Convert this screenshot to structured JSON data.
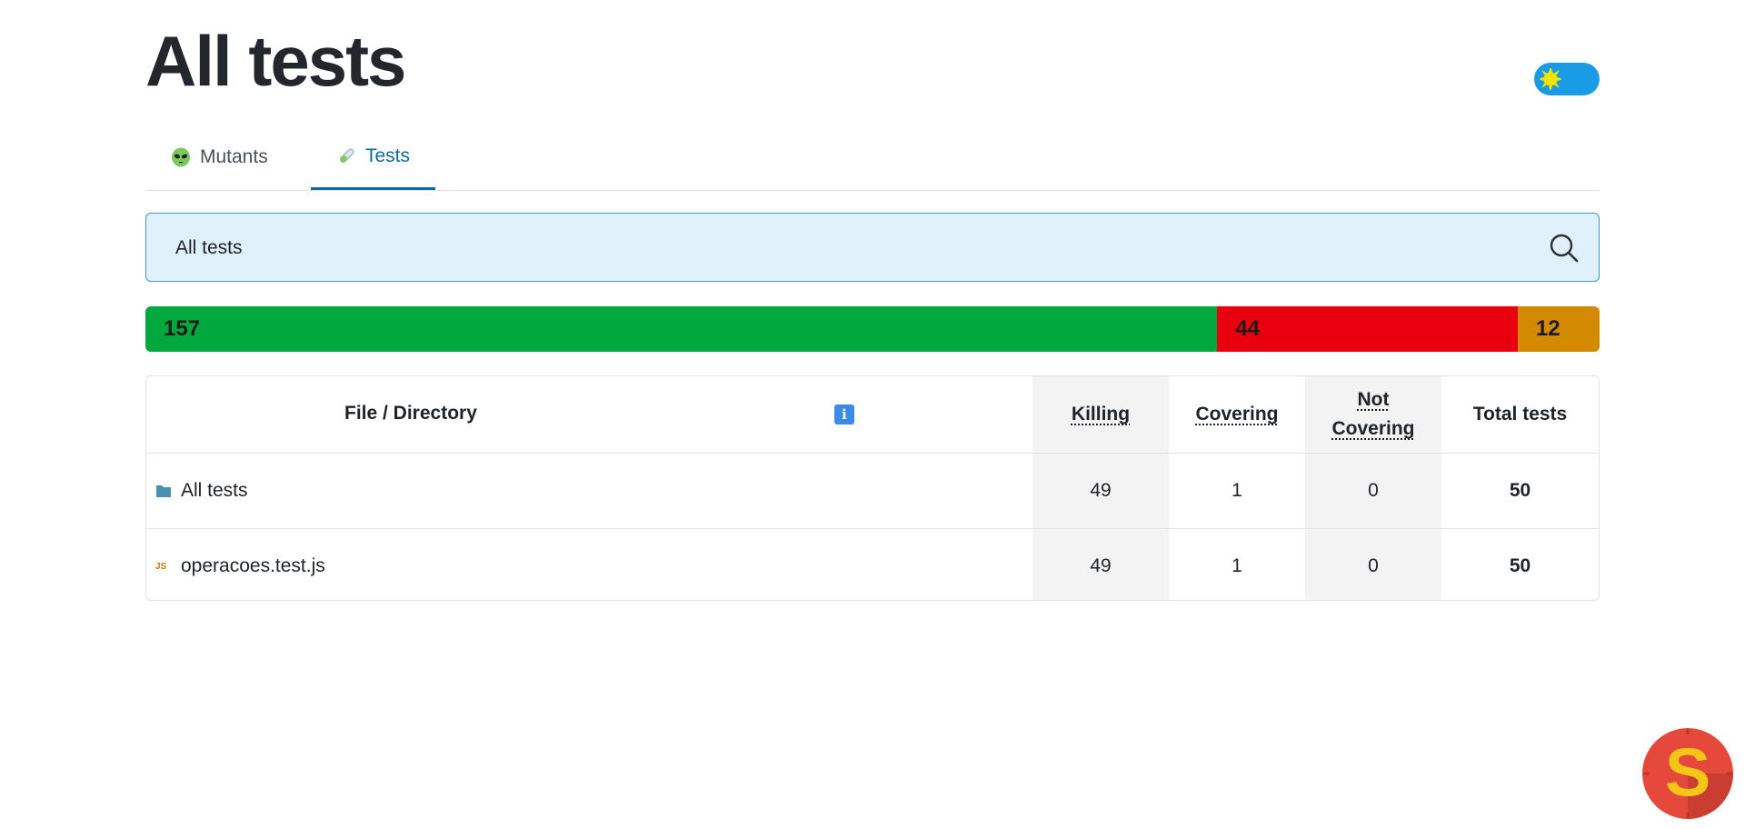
{
  "page": {
    "title": "All tests"
  },
  "theme_toggle": {
    "icon": "sun-icon",
    "color": "#1a9be6"
  },
  "tabs": [
    {
      "label": "Mutants",
      "icon": "alien-icon",
      "active": false
    },
    {
      "label": "Tests",
      "icon": "test-tube-icon",
      "active": true
    }
  ],
  "search": {
    "value": "All tests",
    "icon": "search-icon"
  },
  "progress": [
    {
      "label": "157",
      "value": 157,
      "color": "#00a83d"
    },
    {
      "label": "44",
      "value": 44,
      "color": "#e8000e"
    },
    {
      "label": "12",
      "value": 12,
      "color": "#d48a00"
    }
  ],
  "table": {
    "headers": {
      "file": "File / Directory",
      "info": "i",
      "killing": "Killing",
      "covering": "Covering",
      "not_covering_1": "Not",
      "not_covering_2": "Covering",
      "total": "Total tests"
    },
    "rows": [
      {
        "name": "All tests",
        "icon": "folder-icon",
        "killing": "49",
        "covering": "1",
        "not_covering": "0",
        "total": "50"
      },
      {
        "name": "operacoes.test.js",
        "icon": "JS",
        "killing": "49",
        "covering": "1",
        "not_covering": "0",
        "total": "50"
      }
    ]
  },
  "logo": {
    "letter": "S",
    "colors": [
      "#e4493b",
      "#f5c518"
    ]
  }
}
